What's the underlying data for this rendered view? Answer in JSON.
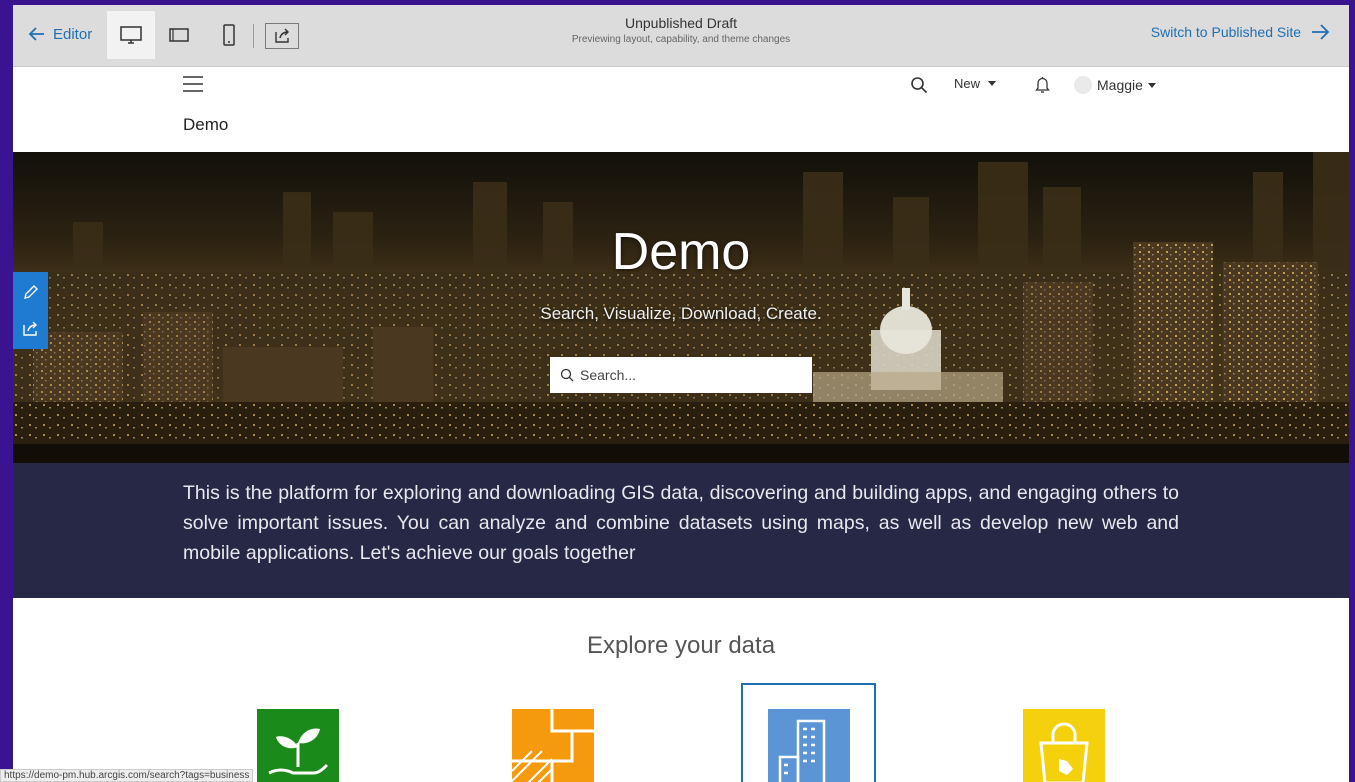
{
  "toolbar": {
    "back_label": "Editor",
    "draft_title": "Unpublished Draft",
    "draft_subtitle": "Previewing layout, capability, and theme changes",
    "switch_label": "Switch to Published Site"
  },
  "header": {
    "site_name": "Demo",
    "new_label": "New",
    "user_name": "Maggie"
  },
  "hero": {
    "title": "Demo",
    "subtitle": "Search, Visualize, Download, Create.",
    "search_placeholder": "Search..."
  },
  "description": "This is the platform for exploring and downloading GIS data, discovering and building apps, and engaging others to solve important issues. You can analyze and combine datasets using maps, as well as develop new web and mobile applications. Let's achieve our goals together",
  "explore": {
    "title": "Explore your data",
    "tiles": [
      {
        "icon": "plant-hand-icon",
        "color": "#1a8a1a"
      },
      {
        "icon": "parcels-icon",
        "color": "#f59a0c"
      },
      {
        "icon": "buildings-icon",
        "color": "#5b95d6"
      },
      {
        "icon": "shopping-bag-icon",
        "color": "#f5d00c"
      }
    ]
  },
  "status_url": "https://demo-pm.hub.arcgis.com/search?tags=business",
  "colors": {
    "accent": "#1f6fb5",
    "background": "#3a1490",
    "band": "#262845",
    "edit_rail": "#1f7ad1"
  }
}
